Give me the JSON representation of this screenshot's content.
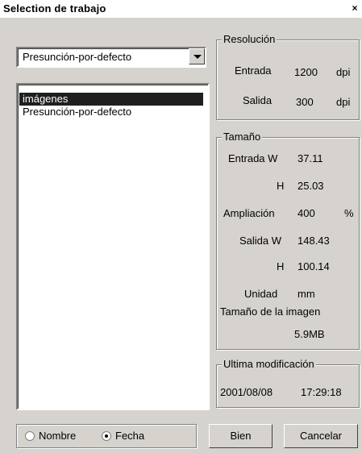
{
  "window": {
    "title": "Selection de trabajo",
    "close_glyph": "×"
  },
  "profile_combo": {
    "selected": "Presunción-por-defecto"
  },
  "job_list": {
    "items": [
      {
        "label": "imágenes",
        "selected": true
      },
      {
        "label": "Presunción-por-defecto",
        "selected": false
      }
    ]
  },
  "resolution": {
    "legend": "Resolución",
    "input_label": "Entrada",
    "input_value": "1200",
    "input_unit": "dpi",
    "output_label": "Salida",
    "output_value": "300",
    "output_unit": "dpi"
  },
  "size": {
    "legend": "Tamaño",
    "input_w_label": "Entrada W",
    "input_w_value": "37.11",
    "input_h_label": "H",
    "input_h_value": "25.03",
    "zoom_label": "Ampliación",
    "zoom_value": "400",
    "zoom_unit": "%",
    "output_w_label": "Salida W",
    "output_w_value": "148.43",
    "output_h_label": "H",
    "output_h_value": "100.14",
    "unit_label": "Unidad",
    "unit_value": "mm",
    "image_size_label": "Tamaño de la imagen",
    "image_size_value": "5.9MB"
  },
  "last_modified": {
    "legend": "Ultima modificación",
    "date": "2001/08/08",
    "time": "17:29:18"
  },
  "sort": {
    "name_label": "Nombre",
    "date_label": "Fecha",
    "selected": "date"
  },
  "buttons": {
    "ok_label": "Bien",
    "cancel_label": "Cancelar"
  }
}
